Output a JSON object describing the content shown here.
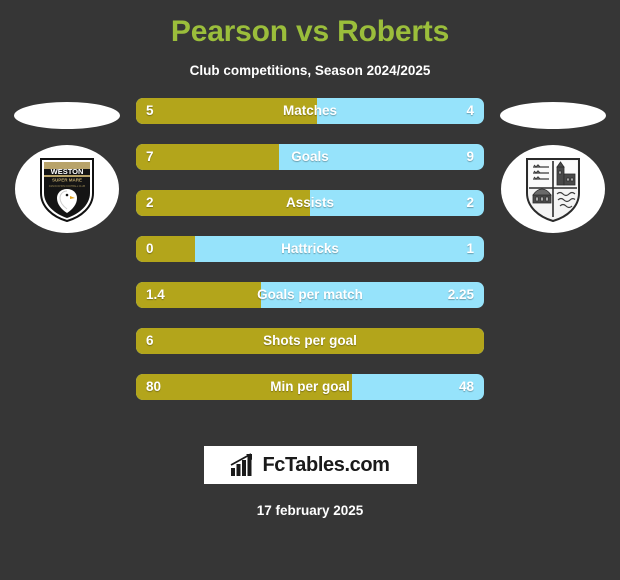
{
  "header": {
    "title": "Pearson vs Roberts",
    "subtitle": "Club competitions, Season 2024/2025",
    "title_color": "#9BBE3B"
  },
  "colors": {
    "background": "#363636",
    "home_bar": "#B3A51B",
    "away_bar": "#96E3FB",
    "text": "#ffffff"
  },
  "teams": {
    "home": {
      "crest_name": "weston-super-mare-afc-crest",
      "crest_line1": "WESTON",
      "crest_line2": "SUPER MARE",
      "crest_line3": "ASSOCIATION FOOTBALL CLUB"
    },
    "away": {
      "crest_name": "quartered-shield-crest"
    }
  },
  "stats": [
    {
      "label": "Matches",
      "home": "5",
      "away": "4",
      "home_pct": 52
    },
    {
      "label": "Goals",
      "home": "7",
      "away": "9",
      "home_pct": 41
    },
    {
      "label": "Assists",
      "home": "2",
      "away": "2",
      "home_pct": 50
    },
    {
      "label": "Hattricks",
      "home": "0",
      "away": "1",
      "home_pct": 17
    },
    {
      "label": "Goals per match",
      "home": "1.4",
      "away": "2.25",
      "home_pct": 36
    },
    {
      "label": "Shots per goal",
      "home": "6",
      "away": "",
      "home_pct": 100
    },
    {
      "label": "Min per goal",
      "home": "80",
      "away": "48",
      "home_pct": 62
    }
  ],
  "footer": {
    "brand": "FcTables.com",
    "brand_icon": "bar-chart-icon",
    "date": "17 february 2025"
  }
}
